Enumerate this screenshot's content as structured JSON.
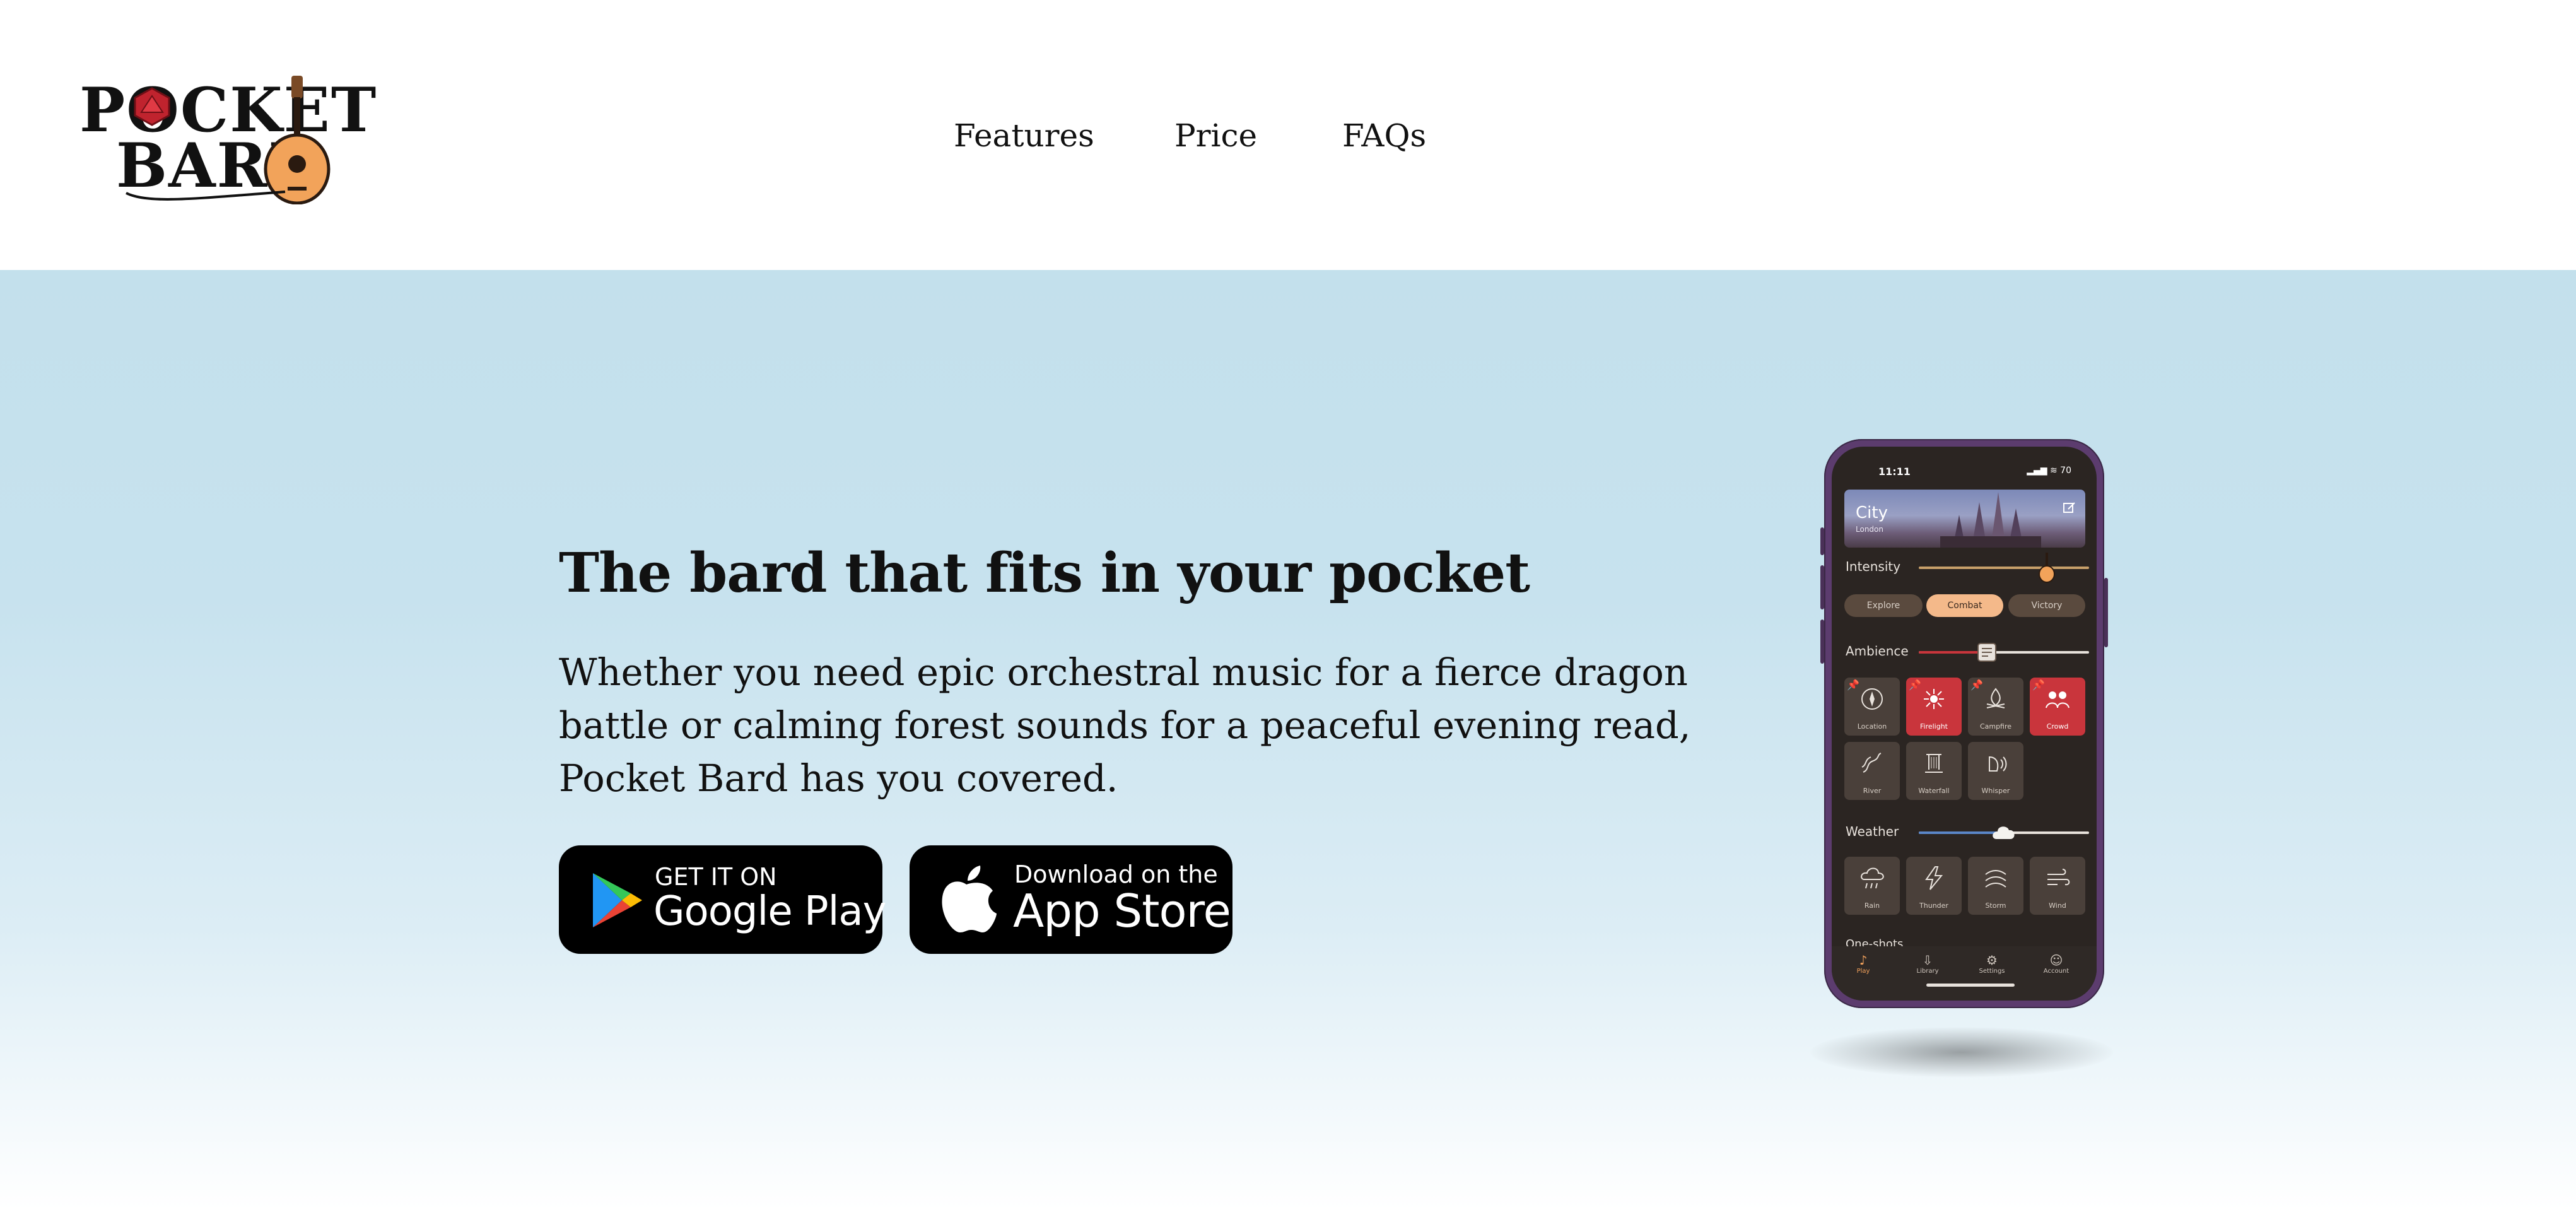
{
  "brand": {
    "logo_line1": "POCKET",
    "logo_line2": "BARD"
  },
  "nav": {
    "features": "Features",
    "price": "Price",
    "faqs": "FAQs"
  },
  "hero": {
    "title": "The bard that fits in your pocket",
    "description": "Whether you need epic orchestral music for a fierce dragon battle or calming forest sounds for a peaceful evening read, Pocket Bard has you covered.",
    "google_small": "GET IT ON",
    "google_big": "Google Play",
    "apple_small": "Download on the",
    "apple_big": "App Store"
  },
  "phone": {
    "status_time": "11:11",
    "status_icons": "▂▄▆ ≋ 70",
    "banner_title": "City",
    "banner_sub": "London",
    "intensity_label": "Intensity",
    "intensity_level": 0.75,
    "pills": [
      "Explore",
      "Combat",
      "Victory"
    ],
    "active_pill": "Combat",
    "ambience_label": "Ambience",
    "ambience_level": 0.4,
    "ambience_tiles": [
      "Location",
      "Firelight",
      "Campfire",
      "Crowd",
      "River",
      "Waterfall",
      "Whisper"
    ],
    "weather_label": "Weather",
    "weather_level": 0.5,
    "weather_tiles": [
      "Rain",
      "Thunder",
      "Storm",
      "Wind"
    ],
    "oneshots_label": "One-shots",
    "tabs": [
      "Play",
      "Library",
      "Settings",
      "Account"
    ]
  },
  "colors": {
    "hero_top": "#c3e0ec",
    "accent_orange": "#f3a25c",
    "tile_red": "#c9353c",
    "phone_frame": "#5c3c6e"
  }
}
